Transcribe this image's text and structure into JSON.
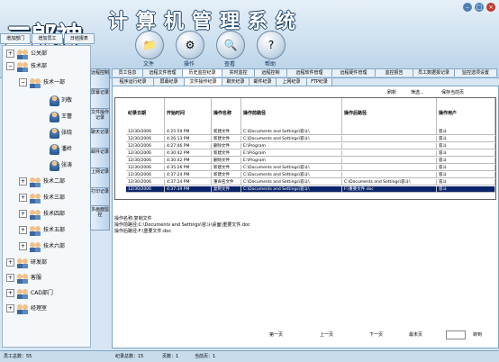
{
  "app": {
    "logo": "二郎神",
    "title": "计算机管理系统"
  },
  "toolbar": [
    {
      "label": "文件",
      "icon": "file-icon"
    },
    {
      "label": "操作",
      "icon": "gear-icon"
    },
    {
      "label": "查看",
      "icon": "view-icon"
    },
    {
      "label": "帮助",
      "icon": "help-icon"
    }
  ],
  "left_tabs": [
    "增加部门",
    "增加员工",
    "日结报表"
  ],
  "tree": [
    {
      "label": "公关部",
      "kind": "group",
      "expander": "+"
    },
    {
      "label": "技术部",
      "kind": "group",
      "expander": "−"
    },
    {
      "label": "技术一部",
      "kind": "group",
      "expander": "−"
    },
    {
      "label": "刘敬",
      "kind": "person"
    },
    {
      "label": "王蕾",
      "kind": "person"
    },
    {
      "label": "张晓",
      "kind": "person"
    },
    {
      "label": "潘岭",
      "kind": "person"
    },
    {
      "label": "张涛",
      "kind": "person"
    },
    {
      "label": "技术二部",
      "kind": "group",
      "expander": "+"
    },
    {
      "label": "技术三部",
      "kind": "group",
      "expander": "+"
    },
    {
      "label": "技术四部",
      "kind": "group",
      "expander": "+"
    },
    {
      "label": "技术五部",
      "kind": "group",
      "expander": "+"
    },
    {
      "label": "技术六部",
      "kind": "group",
      "expander": "+"
    },
    {
      "label": "研发部",
      "kind": "group",
      "expander": "+"
    },
    {
      "label": "客服",
      "kind": "group",
      "expander": "+"
    },
    {
      "label": "CAD部门",
      "kind": "group",
      "expander": "+"
    },
    {
      "label": "经理室",
      "kind": "group",
      "expander": "+"
    }
  ],
  "vertical_tabs": [
    "远程控制",
    "屏幕记录",
    "文件操作记录",
    "聊天记录",
    "邮件记录",
    "上网记录",
    "打印记录",
    "多画面监控"
  ],
  "main_tabs": [
    "员工信息",
    "远程文件管理",
    "历史监控纪录",
    "实时监控",
    "远程控制",
    "远程软件管理",
    "远程硬件管理",
    "监控报告",
    "员工数据报记录",
    "监控选项设置"
  ],
  "active_main_tab": 2,
  "sub_tabs": [
    "程序运行纪录",
    "屏幕纪录",
    "文件操作纪录",
    "聊天纪录",
    "邮件纪录",
    "上网纪录",
    "FTP纪录"
  ],
  "active_sub_tab": 2,
  "actions": {
    "refresh": "刷新",
    "filter": "筛选...",
    "save": "保存当前页"
  },
  "table": {
    "columns": [
      "纪录日期",
      "开始时间",
      "操作名称",
      "操作前路径",
      "操作后路径",
      "操作用户"
    ],
    "rows": [
      [
        "12/30/2006",
        "4:25:50 PM",
        "新建文件",
        "C:\\Documents and Settings\\容斗\\",
        "",
        "容斗"
      ],
      [
        "12/30/2006",
        "4:26:13 PM",
        "新建文件",
        "C:\\Documents and Settings\\容斗\\",
        "",
        "容斗"
      ],
      [
        "12/30/2006",
        "4:27:46 PM",
        "删除文件",
        "E:\\Program",
        "",
        "容斗"
      ],
      [
        "12/30/2006",
        "4:30:42 PM",
        "新建文件",
        "E:\\Program",
        "",
        "容斗"
      ],
      [
        "12/30/2006",
        "4:30:42 PM",
        "删除文件",
        "E:\\Program",
        "",
        "容斗"
      ],
      [
        "12/30/2006",
        "4:35:26 PM",
        "新建文件",
        "C:\\Documents and Settings\\容斗\\",
        "",
        "容斗"
      ],
      [
        "12/30/2006",
        "4:37:24 PM",
        "新建文件",
        "C:\\Documents and Settings\\容斗\\",
        "",
        "容斗"
      ],
      [
        "12/30/2006",
        "4:37:24 PM",
        "重命名文件",
        "C:\\Documents and Settings\\容斗\\",
        "C:\\Documents and Settings\\容斗\\",
        "容斗"
      ],
      [
        "12/30/2006",
        "4:37:39 PM",
        "复制文件",
        "C:\\Documents and Settings\\容斗\\",
        "F:\\重要文件.doc",
        "容斗"
      ]
    ],
    "selected_row": 8
  },
  "detail": {
    "line1": "操作名称:复制文件",
    "line2": "操作前路径:C:\\Documents and Settings\\容斗\\桌面\\重要文件.doc",
    "line3": "操作后路径:F:\\重要文件.doc"
  },
  "pager": {
    "first": "第一页",
    "prev": "上一页",
    "next": "下一页",
    "last": "最末页",
    "goto": "转到"
  },
  "status": {
    "staff": "员工总数：55",
    "records": "纪录总数：15",
    "pages": "页数：1",
    "current": "当前页：1"
  },
  "colors": {
    "selection": "#0a246a",
    "panel": "#d7e6f2",
    "border": "#7fa3c4"
  }
}
